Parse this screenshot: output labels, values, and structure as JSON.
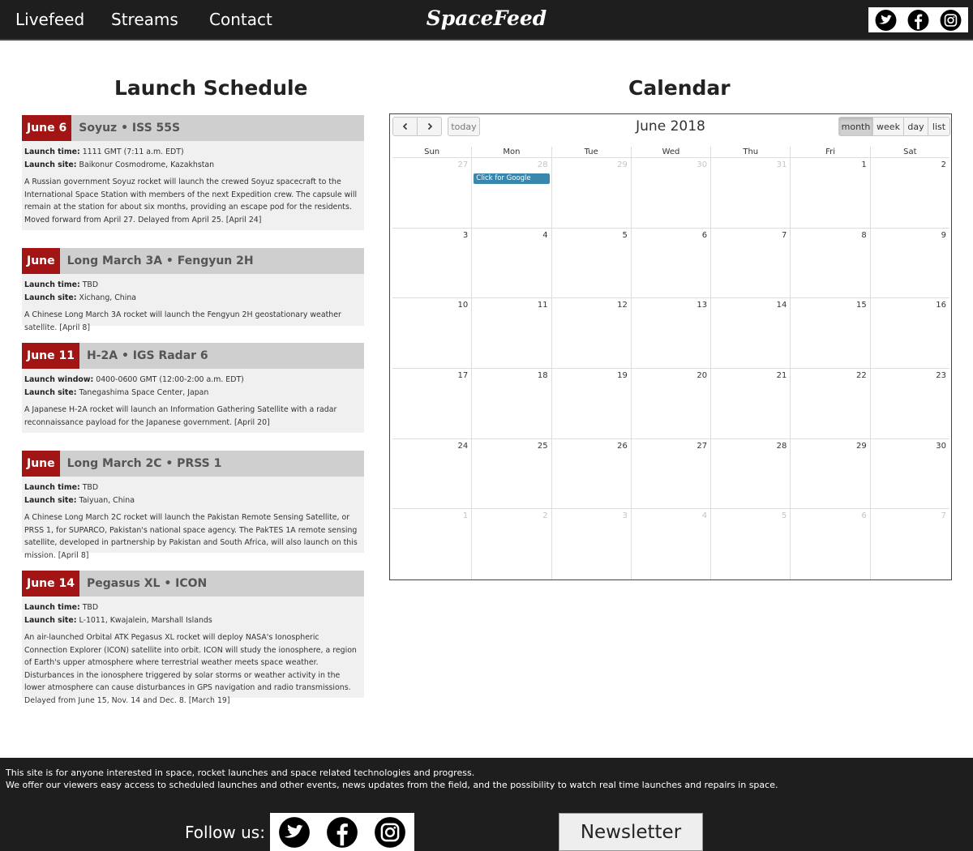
{
  "nav": {
    "links": [
      "Livefeed",
      "Streams",
      "Contact"
    ],
    "brand": "SpaceFeed",
    "social_icons": [
      "twitter-icon",
      "facebook-icon",
      "instagram-icon"
    ]
  },
  "schedule": {
    "title": "Launch Schedule",
    "launches": [
      {
        "date": "June 6",
        "name": "Soyuz • ISS 55S",
        "time_label": "Launch time:",
        "time": "1111 GMT (7:11 a.m. EDT)",
        "site_label": "Launch site:",
        "site": "Baikonur Cosmodrome, Kazakhstan",
        "description": "A Russian government Soyuz rocket will launch the crewed Soyuz spacecraft to the International Space Station with members of the next Expedition crew. The capsule will remain at the station for about six months, providing an escape pod for the residents. Moved forward from April 27. Delayed from April 25. [April 24]"
      },
      {
        "date": "June",
        "name": "Long March 3A • Fengyun 2H",
        "time_label": "Launch time:",
        "time": "TBD",
        "site_label": "Launch site:",
        "site": "Xichang, China",
        "description": "A Chinese Long March 3A rocket will launch the Fengyun 2H geostationary weather satellite. [April 8]"
      },
      {
        "date": "June 11",
        "name": "H-2A • IGS Radar 6",
        "time_label": "Launch window:",
        "time": "0400-0600 GMT (12:00-2:00 a.m. EDT)",
        "site_label": "Launch site:",
        "site": "Tanegashima Space Center, Japan",
        "description": "A Japanese H-2A rocket will launch an Information Gathering Satellite with a radar reconnaissance payload for the Japanese government. [April 20]"
      },
      {
        "date": "June",
        "name": "Long March 2C • PRSS 1",
        "time_label": "Launch time:",
        "time": "TBD",
        "site_label": "Launch site:",
        "site": "Taiyuan, China",
        "description": "A Chinese Long March 2C rocket will launch the Pakistan Remote Sensing Satellite, or PRSS 1, for SUPARCO, Pakistan's national space agency. The PakTES 1A remote sensing satellite, developed in partnership by Pakistan and South Africa, will also launch on this mission. [April 8]"
      },
      {
        "date": "June 14",
        "name": "Pegasus XL • ICON",
        "time_label": "Launch time:",
        "time": "TBD",
        "site_label": "Launch site:",
        "site": "L-1011, Kwajalein, Marshall Islands",
        "description": "An air-launched Orbital ATK Pegasus XL rocket will deploy NASA's Ionospheric Connection Explorer (ICON) satellite into orbit. ICON will study the ionosphere, a region of Earth's upper atmosphere where terrestrial weather meets space weather. Disturbances in the ionosphere triggered by solar storms or weather activity in the lower atmosphere can cause disturbances in GPS navigation and radio transmissions. Delayed from June 15, Nov. 14 and Dec. 8. [March 19]"
      }
    ]
  },
  "calendar": {
    "section_title": "Calendar",
    "title": "June 2018",
    "prev_icon": "chevron-left-icon",
    "next_icon": "chevron-right-icon",
    "today_label": "today",
    "views": [
      "month",
      "week",
      "day",
      "list"
    ],
    "active_view": "month",
    "days_of_week": [
      "Sun",
      "Mon",
      "Tue",
      "Wed",
      "Thu",
      "Fri",
      "Sat"
    ],
    "weeks": [
      [
        "27",
        "28",
        "29",
        "30",
        "31",
        "1",
        "2"
      ],
      [
        "3",
        "4",
        "5",
        "6",
        "7",
        "8",
        "9"
      ],
      [
        "10",
        "11",
        "12",
        "13",
        "14",
        "15",
        "16"
      ],
      [
        "17",
        "18",
        "19",
        "20",
        "21",
        "22",
        "23"
      ],
      [
        "24",
        "25",
        "26",
        "27",
        "28",
        "29",
        "30"
      ],
      [
        "1",
        "2",
        "3",
        "4",
        "5",
        "6",
        "7"
      ]
    ],
    "event": {
      "label": "Click for Google",
      "week": 0,
      "day": 1,
      "color": "#3a87ad"
    }
  },
  "footer": {
    "line1": "This site is for anyone interested in space, rocket launches and space related  technologies and progress.",
    "line2": "We offer our viewers easy access to scheduled launches and other events, news updates from the field, and the possibility to watch real time launches and repairs in space.",
    "follow_label": "Follow us:",
    "newsletter_label": "Newsletter"
  },
  "colors": {
    "dark_bar": "#1e1e1e",
    "launch_date_bg": "#a31515",
    "launch_head_bg": "#cfcfcf",
    "event_bg": "#3a87ad"
  }
}
